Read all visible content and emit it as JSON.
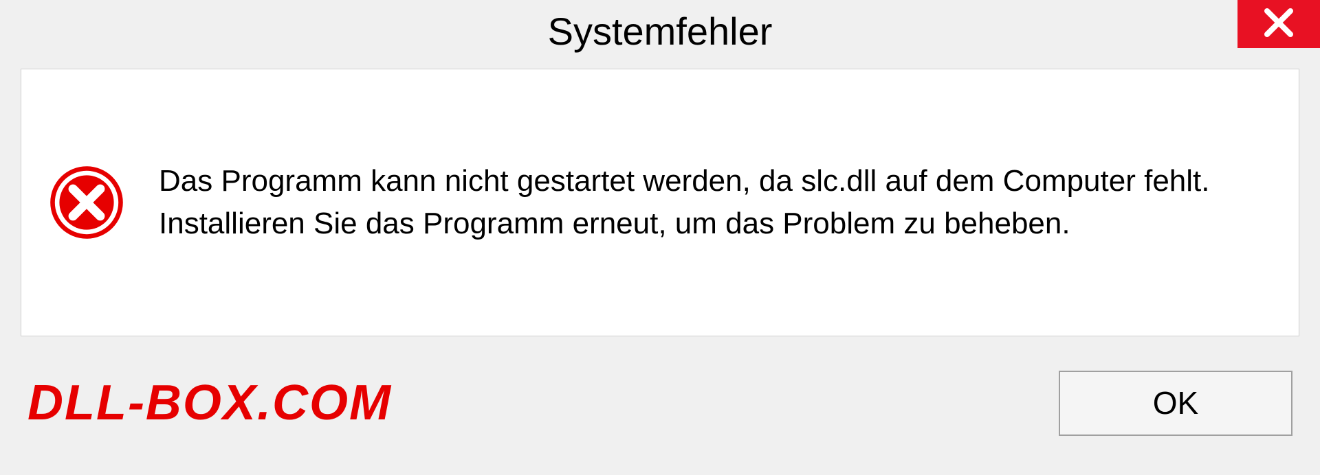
{
  "dialog": {
    "title": "Systemfehler",
    "message": "Das Programm kann nicht gestartet werden, da slc.dll auf dem Computer fehlt. Installieren Sie das Programm erneut, um das Problem zu beheben.",
    "ok_label": "OK"
  },
  "watermark": "DLL-BOX.COM"
}
